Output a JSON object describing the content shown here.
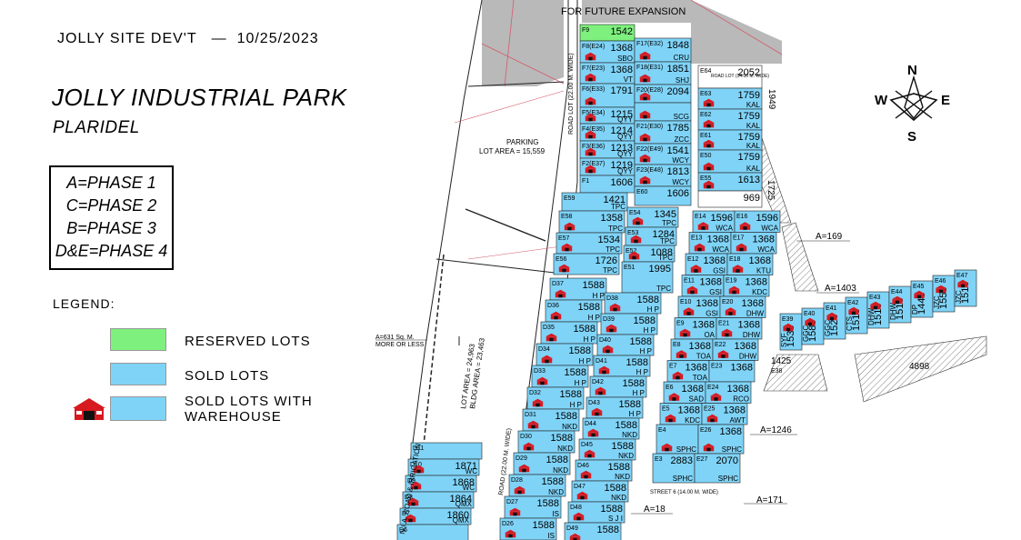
{
  "header": {
    "project": "JOLLY SITE DEV'T",
    "dash": "—",
    "date": "10/25/2023"
  },
  "title": "JOLLY INDUSTRIAL PARK",
  "subtitle": "PLARIDEL",
  "phases": [
    "A=PHASE 1",
    "C=PHASE 2",
    "B=PHASE 3",
    "D&E=PHASE 4"
  ],
  "legend": {
    "title": "LEGEND:",
    "items": [
      {
        "label": "RESERVED LOTS",
        "color": "#7ef07e"
      },
      {
        "label": "SOLD LOTS",
        "color": "#7fd3f7"
      },
      {
        "label": "SOLD LOTS WITH\nWAREHOUSE",
        "color": "#7fd3f7",
        "icon": "warehouse-icon"
      }
    ]
  },
  "compass": {
    "n": "N",
    "s": "S",
    "e": "E",
    "w": "W"
  },
  "map_labels": {
    "future": "FOR FUTURE EXPANSION",
    "parking": "PARKING",
    "parking_area": "LOT AREA = 15,559",
    "road_lot_top": "ROAD LOT (22.00 M. WIDE)",
    "road_lot_mid": "ROAD (22.00 M. WIDE)",
    "road_lot_top_right": "ROAD LOT (14.00 M. WIDE)",
    "street6": "STREET 6 (14.00 M. WIDE)",
    "irrigation": "N.I.A. ROAD & IRRIGATION",
    "lot_area": "LOT AREA = 24,963",
    "bldg_area": "BLDG AREA = 23,463",
    "a631": "A=631 Sq. M.",
    "a631b": "MORE OR LESS",
    "a169": "A=169",
    "a1403": "A=1403",
    "a1246": "A=1246",
    "a171": "A=171",
    "a18": "A=18",
    "v1949": "1949",
    "v1725": "1725",
    "v1425": "1425",
    "v4898": "4898",
    "e38": "E38"
  },
  "lots_col1": [
    {
      "id": "F9",
      "num": "1542",
      "code": "",
      "reserved": true,
      "wh": false
    },
    {
      "id": "F8(E24)",
      "num": "1368",
      "code": "SBO",
      "wh": true
    },
    {
      "id": "F7(E23)",
      "num": "1368",
      "code": "VT",
      "wh": true
    },
    {
      "id": "F6(E33)",
      "num": "1791",
      "code": "",
      "wh": true
    },
    {
      "id": "F5(E34)",
      "num": "1215",
      "code": "QYY",
      "wh": true
    },
    {
      "id": "F4(E35)",
      "num": "1214",
      "code": "QYY",
      "wh": true
    },
    {
      "id": "F3(E36)",
      "num": "1213",
      "code": "QYY",
      "wh": true
    },
    {
      "id": "F2(E37)",
      "num": "1219",
      "code": "QYY",
      "wh": true
    },
    {
      "id": "F1",
      "num": "1606",
      "code": "",
      "wh": false
    }
  ],
  "lots_col2": [
    {
      "id": "F17(E32)",
      "num": "1848",
      "code": "CRU",
      "wh": true
    },
    {
      "id": "F18(E31)",
      "num": "1851",
      "code": "SHJ",
      "wh": true
    },
    {
      "id": "F20(E28)",
      "num": "2094",
      "code": "",
      "wh": true
    },
    {
      "id": "",
      "num": "",
      "code": "SCG",
      "wh": true
    },
    {
      "id": "F21(E30)",
      "num": "1785",
      "code": "ZCC",
      "wh": true
    },
    {
      "id": "F22(E49)",
      "num": "1541",
      "code": "WCY",
      "wh": true
    },
    {
      "id": "F23(E48)",
      "num": "1813",
      "code": "WCY",
      "wh": true
    },
    {
      "id": "E60",
      "num": "1606",
      "code": "",
      "wh": false
    }
  ],
  "lots_col3": [
    {
      "id": "E64",
      "num": "2052",
      "code": "",
      "white": true
    },
    {
      "id": "E63",
      "num": "1759",
      "code": "KAL",
      "wh": true
    },
    {
      "id": "E62",
      "num": "1759",
      "code": "KAL",
      "wh": true
    },
    {
      "id": "E61",
      "num": "1759",
      "code": "KAL",
      "wh": true
    },
    {
      "id": "E50",
      "num": "1759",
      "code": "KAL",
      "wh": true
    },
    {
      "id": "E55",
      "num": "1613",
      "code": "",
      "wh": true
    },
    {
      "id": "",
      "num": "969",
      "code": "",
      "white": true
    }
  ],
  "lots_left_block": [
    {
      "id": "E59",
      "num": "1421",
      "code": "TPC"
    },
    {
      "id": "E58",
      "num": "1358",
      "code": "TPC"
    },
    {
      "id": "E57",
      "num": "1534",
      "code": "TPC"
    },
    {
      "id": "E56",
      "num": "1726",
      "code": "TPC"
    }
  ],
  "lots_mid_block": [
    {
      "id": "E54",
      "num": "1345",
      "code": "TPC"
    },
    {
      "id": "E53",
      "num": "1284",
      "code": "TPC"
    },
    {
      "id": "E52",
      "num": "1088",
      "code": "TPC"
    },
    {
      "id": "E51",
      "num": "1995",
      "code": "TPC"
    }
  ],
  "lots_east_block": [
    {
      "id": "E14",
      "num": "1596",
      "code": "WCA"
    },
    {
      "id": "E16",
      "num": "1596",
      "code": "WCA"
    },
    {
      "id": "E13",
      "num": "1368",
      "code": "WCA"
    },
    {
      "id": "E17",
      "num": "1368",
      "code": "WCA"
    },
    {
      "id": "E12",
      "num": "1368",
      "code": "GSI"
    },
    {
      "id": "E18",
      "num": "1368",
      "code": "KTU"
    },
    {
      "id": "E11",
      "num": "1368",
      "code": "GSI"
    },
    {
      "id": "E19",
      "num": "1368",
      "code": "KDC"
    },
    {
      "id": "E10",
      "num": "1368",
      "code": "GSI"
    },
    {
      "id": "E20",
      "num": "1368",
      "code": "DHW"
    },
    {
      "id": "E9",
      "num": "1368",
      "code": "OA"
    },
    {
      "id": "E21",
      "num": "1368",
      "code": "DHW"
    },
    {
      "id": "E8",
      "num": "1368",
      "code": "TOA"
    },
    {
      "id": "E22",
      "num": "1368",
      "code": "DHW"
    },
    {
      "id": "E7",
      "num": "1368",
      "code": "TOA"
    },
    {
      "id": "E23",
      "num": "1368",
      "code": ""
    },
    {
      "id": "E6",
      "num": "1368",
      "code": "SAD"
    },
    {
      "id": "E24",
      "num": "1368",
      "code": "RCO"
    },
    {
      "id": "E5",
      "num": "1368",
      "code": "KDC"
    },
    {
      "id": "E25",
      "num": "1368",
      "code": "AWT"
    },
    {
      "id": "E4",
      "num": "",
      "code": "SPHC"
    },
    {
      "id": "E26",
      "num": "1368",
      "code": "SPHC"
    },
    {
      "id": "E3",
      "num": "2883",
      "code": "SPHC"
    },
    {
      "id": "E27",
      "num": "2070",
      "code": "SPHC"
    }
  ],
  "lots_d_left": [
    {
      "id": "D37",
      "num": "1588",
      "code": "H P"
    },
    {
      "id": "D36",
      "num": "1588",
      "code": "H P"
    },
    {
      "id": "D35",
      "num": "1588",
      "code": "H P"
    },
    {
      "id": "D34",
      "num": "1588",
      "code": "H P"
    },
    {
      "id": "D33",
      "num": "1588",
      "code": "H P"
    },
    {
      "id": "D32",
      "num": "1588",
      "code": "H P"
    },
    {
      "id": "D31",
      "num": "1588",
      "code": "NKD"
    },
    {
      "id": "D30",
      "num": "1588",
      "code": "NKD"
    },
    {
      "id": "D29",
      "num": "1588",
      "code": "NKD"
    },
    {
      "id": "D28",
      "num": "1588",
      "code": "NKD"
    },
    {
      "id": "D27",
      "num": "1588",
      "code": "IS"
    },
    {
      "id": "D26",
      "num": "1588",
      "code": "IS"
    }
  ],
  "lots_d_right": [
    {
      "id": "D38",
      "num": "1588",
      "code": "H P"
    },
    {
      "id": "D39",
      "num": "1588",
      "code": "H P"
    },
    {
      "id": "D40",
      "num": "1588",
      "code": "H P"
    },
    {
      "id": "D41",
      "num": "1588",
      "code": "H P"
    },
    {
      "id": "D42",
      "num": "1588",
      "code": "H P"
    },
    {
      "id": "D43",
      "num": "1588",
      "code": "H P"
    },
    {
      "id": "D44",
      "num": "1588",
      "code": "NKD"
    },
    {
      "id": "D45",
      "num": "1588",
      "code": "NKD"
    },
    {
      "id": "D46",
      "num": "1588",
      "code": "NKD"
    },
    {
      "id": "D47",
      "num": "1588",
      "code": "NKD"
    },
    {
      "id": "D48",
      "num": "1588",
      "code": "S J I"
    },
    {
      "id": "D49",
      "num": "1588",
      "code": ""
    }
  ],
  "lots_dwc": [
    {
      "id": "D11",
      "num": "",
      "code": ""
    },
    {
      "id": "D10",
      "num": "1871",
      "code": "WC"
    },
    {
      "id": "D9",
      "num": "1868",
      "code": "WC"
    },
    {
      "id": "D8",
      "num": "1864",
      "code": "QMX"
    },
    {
      "id": "D7",
      "num": "1860",
      "code": "QMX"
    },
    {
      "id": "D6",
      "num": "",
      "code": ""
    }
  ],
  "lots_e_strip": [
    {
      "id": "E39",
      "num": "1535",
      "code": "SYF"
    },
    {
      "id": "E40",
      "num": "1589",
      "code": "GGC"
    },
    {
      "id": "E41",
      "num": "1526",
      "code": "GGC"
    },
    {
      "id": "E42",
      "num": "1516",
      "code": "CTS"
    },
    {
      "id": "E43",
      "num": "1516",
      "code": "DHW"
    },
    {
      "id": "E44",
      "num": "1516",
      "code": "DHW"
    },
    {
      "id": "E45",
      "num": "1445",
      "code": "DP"
    },
    {
      "id": "E46",
      "num": "1555",
      "code": "JZC"
    },
    {
      "id": "E47",
      "num": "1516",
      "code": "JZC"
    }
  ]
}
